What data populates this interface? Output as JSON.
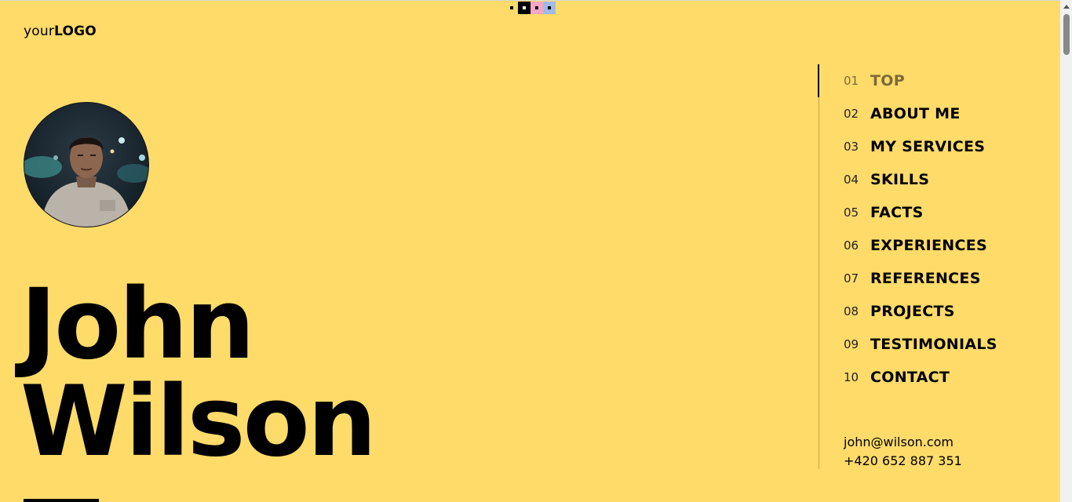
{
  "header": {
    "logo_light": "your",
    "logo_bold": "LOGO"
  },
  "theme": {
    "background": "#ffdb6a",
    "swatches": [
      "#ffdb6a",
      "#000000",
      "#f3a6c8",
      "#9fbbe8"
    ]
  },
  "hero": {
    "first_name": "John",
    "last_name": "Wilson",
    "avatar_icon": "profile-photo"
  },
  "nav": {
    "items": [
      {
        "num": "01",
        "label": "TOP",
        "active": true
      },
      {
        "num": "02",
        "label": "ABOUT ME"
      },
      {
        "num": "03",
        "label": "MY SERVICES"
      },
      {
        "num": "04",
        "label": "SKILLS"
      },
      {
        "num": "05",
        "label": "FACTS"
      },
      {
        "num": "06",
        "label": "EXPERIENCES"
      },
      {
        "num": "07",
        "label": "REFERENCES"
      },
      {
        "num": "08",
        "label": "PROJECTS"
      },
      {
        "num": "09",
        "label": "TESTIMONIALS"
      },
      {
        "num": "10",
        "label": "CONTACT"
      }
    ]
  },
  "contact": {
    "email": "john@wilson.com",
    "phone": "+420 652 887 351"
  }
}
